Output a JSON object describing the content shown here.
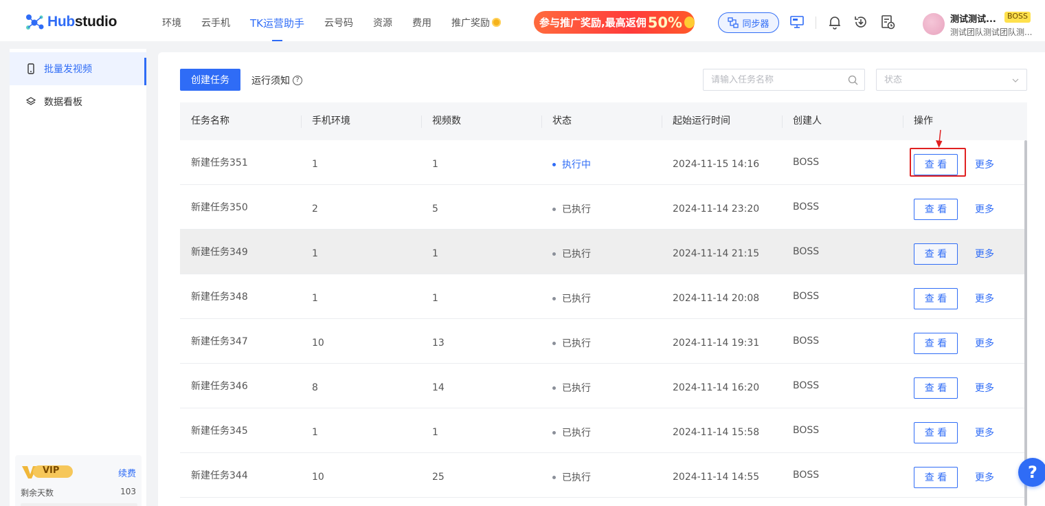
{
  "app": {
    "logo_prefix": "Hub",
    "logo_suffix": "studio"
  },
  "nav": {
    "items": [
      {
        "label": "环境"
      },
      {
        "label": "云手机"
      },
      {
        "label": "TK运营助手",
        "active": true
      },
      {
        "label": "云号码"
      },
      {
        "label": "资源"
      },
      {
        "label": "费用"
      },
      {
        "label": "推广奖励"
      }
    ],
    "promo_text": "参与推广奖励,最高返佣",
    "promo_percent": "50%",
    "sync_label": "同步器"
  },
  "user": {
    "name": "测试测试...",
    "role_badge": "BOSS",
    "team": "测试团队测试团队测..."
  },
  "sidebar": {
    "items": [
      {
        "label": "批量发视频",
        "icon": "phone-icon",
        "active": true
      },
      {
        "label": "数据看板",
        "icon": "layers-icon",
        "active": false
      }
    ],
    "vip": {
      "badge": "VIP",
      "renew_label": "续费",
      "remain_label": "剩余天数",
      "remain_value": "103"
    }
  },
  "toolbar": {
    "create_label": "创建任务",
    "notice_label": "运行须知",
    "search_placeholder": "请输入任务名称",
    "status_placeholder": "状态"
  },
  "table": {
    "headers": [
      "任务名称",
      "手机环境",
      "视频数",
      "状态",
      "起始运行时间",
      "创建人",
      "操作"
    ],
    "view_label": "查 看",
    "more_label": "更多",
    "rows": [
      {
        "name": "新建任务351",
        "env": "1",
        "videos": "1",
        "status": "执行中",
        "running": true,
        "time": "2024-11-15 14:16",
        "creator": "BOSS"
      },
      {
        "name": "新建任务350",
        "env": "2",
        "videos": "5",
        "status": "已执行",
        "running": false,
        "time": "2024-11-14 23:20",
        "creator": "BOSS"
      },
      {
        "name": "新建任务349",
        "env": "1",
        "videos": "1",
        "status": "已执行",
        "running": false,
        "time": "2024-11-14 21:15",
        "creator": "BOSS"
      },
      {
        "name": "新建任务348",
        "env": "1",
        "videos": "1",
        "status": "已执行",
        "running": false,
        "time": "2024-11-14 20:08",
        "creator": "BOSS"
      },
      {
        "name": "新建任务347",
        "env": "10",
        "videos": "13",
        "status": "已执行",
        "running": false,
        "time": "2024-11-14 19:31",
        "creator": "BOSS"
      },
      {
        "name": "新建任务346",
        "env": "8",
        "videos": "14",
        "status": "已执行",
        "running": false,
        "time": "2024-11-14 16:20",
        "creator": "BOSS"
      },
      {
        "name": "新建任务345",
        "env": "1",
        "videos": "1",
        "status": "已执行",
        "running": false,
        "time": "2024-11-14 15:58",
        "creator": "BOSS"
      },
      {
        "name": "新建任务344",
        "env": "10",
        "videos": "25",
        "status": "已执行",
        "running": false,
        "time": "2024-11-14 14:55",
        "creator": "BOSS"
      }
    ]
  },
  "help_label": "?",
  "colors": {
    "accent": "#2f6cf6",
    "highlight": "#e02020",
    "vip_gold": "#f0b73a"
  }
}
